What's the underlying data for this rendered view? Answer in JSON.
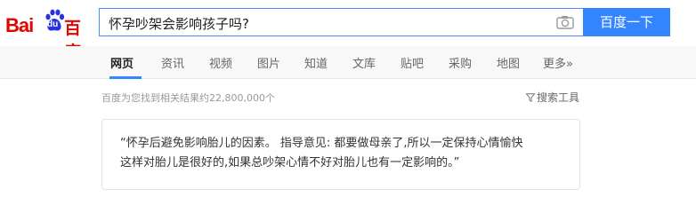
{
  "logo": {
    "bai": "Bai",
    "du": "du",
    "cn": "百度"
  },
  "search": {
    "query": "怀孕吵架会影响孩子吗?",
    "button_label": "百度一下"
  },
  "tabs": [
    {
      "label": "网页",
      "active": true
    },
    {
      "label": "资讯",
      "active": false
    },
    {
      "label": "视频",
      "active": false
    },
    {
      "label": "图片",
      "active": false
    },
    {
      "label": "知道",
      "active": false
    },
    {
      "label": "文库",
      "active": false
    },
    {
      "label": "贴吧",
      "active": false
    },
    {
      "label": "采购",
      "active": false
    },
    {
      "label": "地图",
      "active": false
    },
    {
      "label": "更多»",
      "active": false
    }
  ],
  "results": {
    "count_text": "百度为您找到相关结果约22,800,000个",
    "tools_label": "搜索工具"
  },
  "answer": {
    "line1": "“怀孕后避免影响胎儿的因素。 指导意见: 都要做母亲了,所以一定保持心情愉快",
    "line2": "这样对胎儿是很好的,如果总吵架心情不好对胎儿也有一定影响的。”"
  },
  "colors": {
    "brand_red": "#e10601",
    "brand_blue": "#3385ff",
    "tab_underline": "#3388ff"
  }
}
